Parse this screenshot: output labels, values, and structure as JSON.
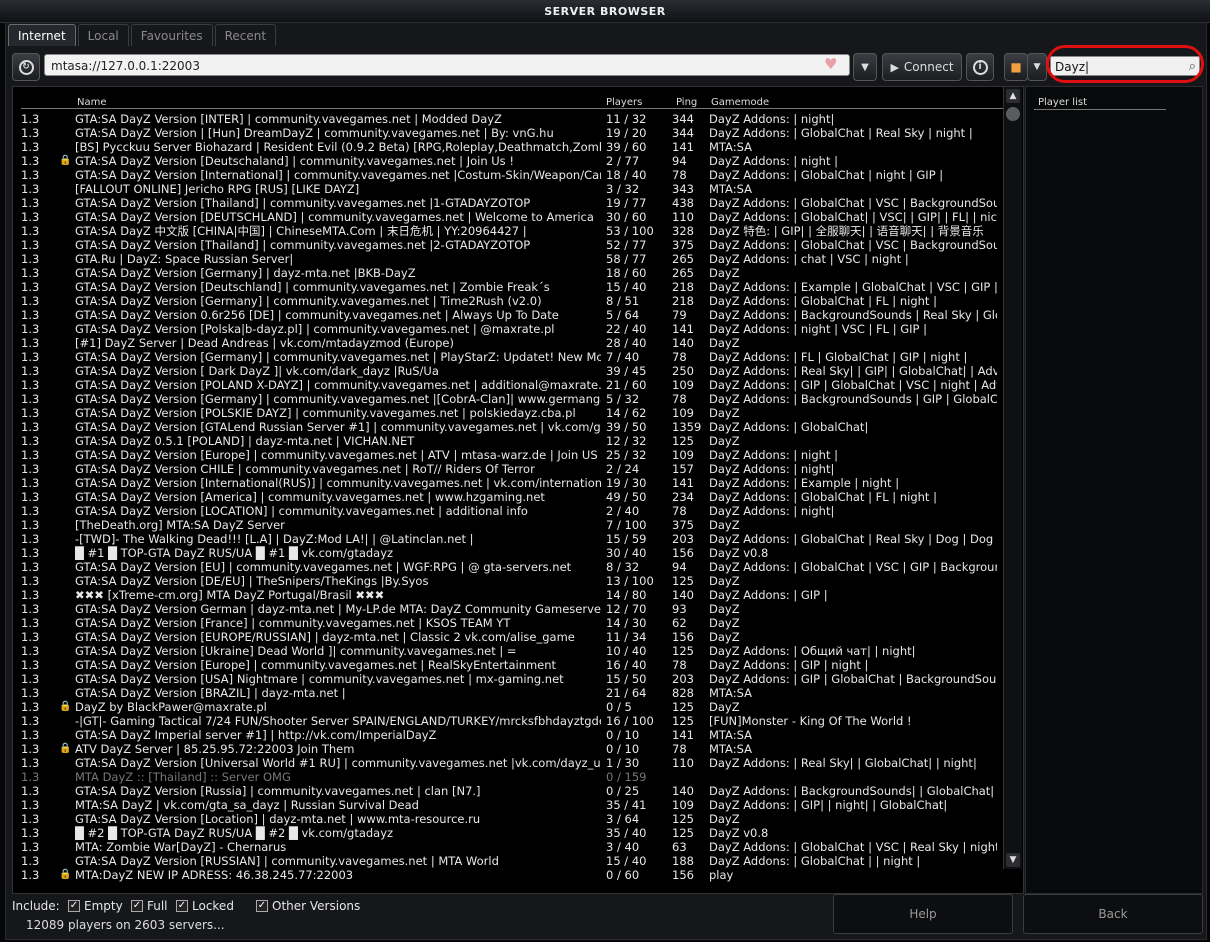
{
  "window": {
    "title": "SERVER BROWSER"
  },
  "tabs": [
    {
      "label": "Internet",
      "active": true
    },
    {
      "label": "Local",
      "active": false
    },
    {
      "label": "Favourites",
      "active": false
    },
    {
      "label": "Recent",
      "active": false
    }
  ],
  "toolbar": {
    "address": "mtasa://127.0.0.1:22003",
    "connect_label": "Connect",
    "search_value": "Dayz"
  },
  "columns": {
    "name": "Name",
    "players": "Players",
    "ping": "Ping",
    "gamemode": "Gamemode"
  },
  "player_list": {
    "title": "Player list"
  },
  "rows": [
    [
      "1.3",
      "",
      "GTA:SA DayZ Version [INTER] | community.vavegames.net | Modded DayZ",
      "11 / 32",
      "344",
      "DayZ Addons: | night|"
    ],
    [
      "1.3",
      "",
      "GTA:SA DayZ Version | [Hun] DreamDayZ | community.vavegames.net | By: vnG.hu",
      "19 / 20",
      "344",
      "DayZ Addons: | GlobalChat | Real Sky | night |"
    ],
    [
      "1.3",
      "",
      "[BS] Pycckuu Server Biohazard | Resident Evil (0.9.2 Beta) [RPG,Roleplay,Deathmatch,Zombie,D",
      "39 / 60",
      "141",
      "MTA:SA"
    ],
    [
      "1.3",
      "lock",
      "GTA:SA DayZ Version  [Deutschaland] | community.vavegames.net | Join Us !",
      "2 / 77",
      "94",
      "DayZ Addons: | night |"
    ],
    [
      "1.3",
      "",
      "GTA:SA DayZ Version [International] | community.vavegames.net |Costum-Skin/Weapon/Cars/C",
      "18 / 40",
      "78",
      "DayZ Addons: | GlobalChat | night | GIP |"
    ],
    [
      "1.3",
      "",
      "[FALLOUT ONLINE] Jericho RPG [RUS] [LIKE DAYZ]",
      "3 / 32",
      "343",
      "MTA:SA"
    ],
    [
      "1.3",
      "",
      "GTA:SA DayZ Version [Thailand] | community.vavegames.net |1-GTADAYZOTOP",
      "19 / 77",
      "438",
      "DayZ Addons: | GlobalChat | VSC | BackgroundSoun"
    ],
    [
      "1.3",
      "",
      "GTA:SA DayZ Version [DEUTSCHLAND] | community.vavegames.net | Welcome to America",
      "30 / 60",
      "110",
      "DayZ Addons: | GlobalChat| | VSC| | GIP| | FL| | nic"
    ],
    [
      "1.3",
      "",
      "GTA:SA DayZ 中文版 [CHINA|中国] | ChineseMTA.Com | 末日危机 | YY:20964427 |",
      "53 / 100",
      "328",
      "DayZ 特色: | GIP| | 全服聊天| | 语音聊天| | 背景音乐"
    ],
    [
      "1.3",
      "",
      "GTA:SA DayZ Version [Thailand] | community.vavegames.net |2-GTADAYZOTOP",
      "52 / 77",
      "375",
      "DayZ Addons: | GlobalChat | VSC | BackgroundSoun"
    ],
    [
      "1.3",
      "",
      "GTA.Ru | DayZ: Space Russian Server|",
      "58 / 77",
      "265",
      "DayZ Addons: | chat | VSC | night |"
    ],
    [
      "1.3",
      "",
      "GTA:SA DayZ Version [Germany] | dayz-mta.net |BKB-DayZ",
      "18 / 60",
      "265",
      "DayZ"
    ],
    [
      "1.3",
      "",
      "GTA:SA DayZ Version [Deutschland] | community.vavegames.net | Zombie Freak´s",
      "15 / 40",
      "218",
      "DayZ Addons: | Example | GlobalChat | VSC | GIP | I"
    ],
    [
      "1.3",
      "",
      "GTA:SA DayZ Version [Germany] | community.vavegames.net | Time2Rush (v2.0)",
      "8 / 51",
      "218",
      "DayZ Addons: | GlobalChat | FL | night |"
    ],
    [
      "1.3",
      "",
      "GTA:SA DayZ Version 0.6r256 [DE] | community.vavegames.net | Always Up To Date",
      "5 / 64",
      "79",
      "DayZ Addons: | BackgroundSounds | Real Sky | Glob"
    ],
    [
      "1.3",
      "",
      "GTA:SA DayZ Version [Polska|b-dayz.pl] | community.vavegames.net | @maxrate.pl",
      "22 / 40",
      "141",
      "DayZ Addons: | night | VSC | FL | GIP |"
    ],
    [
      "1.3",
      "",
      "[#1] DayZ Server | Dead Andreas | vk.com/mtadayzmod (Europe)",
      "28 / 40",
      "140",
      "DayZ"
    ],
    [
      "1.3",
      "",
      "GTA:SA DayZ Version [Germany] | community.vavegames.net | PlayStarZ: Updatet! New Mods,",
      "7 / 40",
      "78",
      "DayZ Addons: | FL | GlobalChat | GIP | night |"
    ],
    [
      "1.3",
      "",
      "GTA:SA DayZ Version [ Dark DayZ ]| vk.com/dark_dayz |RuS/Ua",
      "39 / 45",
      "250",
      "DayZ Addons: | Real Sky| | GIP| | GlobalChat| | Adv"
    ],
    [
      "1.3",
      "",
      "GTA:SA DayZ Version [POLAND X-DAYZ] | community.vavegames.net | additional@maxrate.pl",
      "21 / 60",
      "109",
      "DayZ Addons: | GIP | GlobalChat | VSC | night | Adv"
    ],
    [
      "1.3",
      "",
      "GTA:SA DayZ Version [Germany] | community.vavegames.net |[CobrA-Clan]| www.germangam",
      "5 / 32",
      "78",
      "DayZ Addons: | BackgroundSounds | GIP | GlobalCha"
    ],
    [
      "1.3",
      "",
      "GTA:SA DayZ Version [POLSKIE DAYZ] | community.vavegames.net | polskiedayz.cba.pl",
      "14 / 62",
      "109",
      "DayZ"
    ],
    [
      "1.3",
      "",
      "GTA:SA DayZ Version [GTALend Russian Server #1] | community.vavegames.net | vk.com/gtale",
      "39 / 50",
      "1359",
      "DayZ Addons: | GlobalChat|"
    ],
    [
      "1.3",
      "",
      "GTA:SA DayZ 0.5.1 [POLAND] | dayz-mta.net | VICHAN.NET",
      "12 / 32",
      "125",
      "DayZ"
    ],
    [
      "1.3",
      "",
      "GTA:SA DayZ Version [Europe] | community.vavegames.net | ATV | mtasa-warz.de | Join US 4",
      "25 / 32",
      "109",
      "DayZ Addons: | night |"
    ],
    [
      "1.3",
      "",
      "GTA:SA DayZ Version CHILE | community.vavegames.net | RoT// Riders Of Terror",
      "2 / 24",
      "157",
      "DayZ Addons: | night|"
    ],
    [
      "1.3",
      "",
      "GTA:SA DayZ Version [International(RUS)] | community.vavegames.net | vk.com/internationald",
      "19 / 30",
      "141",
      "DayZ Addons: | Example | night |"
    ],
    [
      "1.3",
      "",
      "GTA:SA DayZ Version [America] | community.vavegames.net | www.hzgaming.net",
      "49 / 50",
      "234",
      "DayZ Addons: | GlobalChat | FL | night |"
    ],
    [
      "1.3",
      "",
      "GTA:SA DayZ Version [LOCATION] | community.vavegames.net | additional info",
      "2 / 40",
      "78",
      "DayZ Addons: | night|"
    ],
    [
      "1.3",
      "",
      "[TheDeath.org] MTA:SA DayZ Server",
      "7 / 100",
      "375",
      "DayZ"
    ],
    [
      "1.3",
      "",
      "-[TWD]- The Walking Dead!!! [L.A] | DayZ:Mod LA!| | @Latinclan.net |",
      "15 / 59",
      "203",
      "DayZ Addons: | GlobalChat | Real Sky | Dog | Dog |"
    ],
    [
      "1.3",
      "",
      "█ #1 █ TOP-GTA DayZ RUS/UA █ #1 █ vk.com/gtadayz",
      "30 / 40",
      "156",
      "DayZ v0.8"
    ],
    [
      "1.3",
      "",
      "GTA:SA DayZ Version [EU] | community.vavegames.net | WGF:RPG | @ gta-servers.net",
      "8 / 32",
      "94",
      "DayZ Addons: | GlobalChat | VSC | GIP | Backgroun"
    ],
    [
      "1.3",
      "",
      "GTA:SA DayZ Version [DE/EU] | TheSnipers/TheKings |By.Syos",
      "13 / 100",
      "125",
      "DayZ"
    ],
    [
      "1.3",
      "",
      "✖✖✖ [xTreme-cm.org] MTA DayZ Portugal/Brasil ✖✖✖",
      "14 / 80",
      "140",
      "DayZ Addons: | GIP |"
    ],
    [
      "1.3",
      "",
      "GTA:SA DayZ Version German | dayz-mta.net | My-LP.de MTA: DayZ Community Gameserver",
      "12 / 70",
      "93",
      "DayZ"
    ],
    [
      "1.3",
      "",
      "GTA:SA DayZ Version [France] | community.vavegames.net | KSOS TEAM YT",
      "14 / 30",
      "62",
      "DayZ"
    ],
    [
      "1.3",
      "",
      "GTA:SA DayZ Version [EUROPE/RUSSIAN] | dayz-mta.net | Classic 2 vk.com/alise_game",
      "11 / 34",
      "156",
      "DayZ"
    ],
    [
      "1.3",
      "",
      "GTA:SA DayZ Version [Ukraine] Dead World                    ]| community.vavegames.net | =",
      "10 / 40",
      "125",
      "DayZ Addons: | Общий чат| | night|"
    ],
    [
      "1.3",
      "",
      "GTA:SA DayZ Version [Europe] | community.vavegames.net | RealSkyEntertainment",
      "16 / 40",
      "78",
      "DayZ Addons: | GIP | night |"
    ],
    [
      "1.3",
      "",
      "GTA:SA DayZ Version [USA] Nightmare | community.vavegames.net | mx-gaming.net",
      "15 / 50",
      "203",
      "DayZ Addons: | GIP | GlobalChat | BackgroundSoun"
    ],
    [
      "1.3",
      "",
      "GTA:SA DayZ Version [BRAZIL] | dayz-mta.net |",
      "21 / 64",
      "828",
      "MTA:SA"
    ],
    [
      "1.3",
      "lock",
      "DayZ by BlackPawer@maxrate.pl",
      "0 / 5",
      "125",
      "DayZ"
    ],
    [
      "1.3",
      "",
      "-|GT|- Gaming Tactical 7/24 FUN/Shooter Server SPAIN/ENGLAND/TURKEY/mrcksfbhdayztgdefa",
      "16 / 100",
      "125",
      "[FUN]Monster - King Of The World !"
    ],
    [
      "1.3",
      "",
      "GTA:SA DayZ Imperial server #1] | http://vk.com/ImperialDayZ",
      "0 / 10",
      "141",
      "MTA:SA"
    ],
    [
      "1.3",
      "lock",
      "ATV DayZ Server | 85.25.95.72:22003 Join Them",
      "0 / 10",
      "78",
      "MTA:SA"
    ],
    [
      "1.3",
      "",
      "GTA:SA DayZ Version [Universal World #1 RU] | community.vavegames.net |vk.com/dayz_unive",
      "1 / 30",
      "110",
      "DayZ Addons: | Real Sky| | GlobalChat| | night|"
    ],
    [
      "1.3",
      "",
      "MTA DayZ :: [Thailand] :: Server OMG",
      "0 / 159",
      "",
      "",
      "grey"
    ],
    [
      "1.3",
      "",
      "GTA:SA DayZ Version [Russia] | community.vavegames.net | clan [N7.]",
      "0 / 25",
      "140",
      "DayZ Addons: | BackgroundSounds| | GlobalChat|"
    ],
    [
      "1.3",
      "",
      "MTA:SA DayZ | vk.com/gta_sa_dayz | Russian Survival Dead",
      "35 / 41",
      "109",
      "DayZ Addons: | GIP| | night| | GlobalChat|"
    ],
    [
      "1.3",
      "",
      "GTA:SA DayZ Version [Location] | dayz-mta.net | www.mta-resource.ru",
      "3 / 64",
      "125",
      "DayZ"
    ],
    [
      "1.3",
      "",
      "█ #2 █ TOP-GTA DayZ RUS/UA █ #2 █ vk.com/gtadayz",
      "35 / 40",
      "125",
      "DayZ v0.8"
    ],
    [
      "1.3",
      "",
      "MTA: Zombie War[DayZ] - Chernarus",
      "3 / 40",
      "63",
      "DayZ Addons: | GlobalChat | VSC | Real Sky | night"
    ],
    [
      "1.3",
      "",
      "GTA:SA DayZ Version [RUSSIAN] | community.vavegames.net | MTA World",
      "15 / 40",
      "188",
      "DayZ Addons: | GlobalChat |   | night |"
    ],
    [
      "1.3",
      "lock",
      "MTA:DayZ NEW IP ADRESS: 46.38.245.77:22003",
      "0 / 60",
      "156",
      "play"
    ]
  ],
  "include": {
    "label": "Include:",
    "options": [
      {
        "label": "Empty",
        "checked": true
      },
      {
        "label": "Full",
        "checked": true
      },
      {
        "label": "Locked",
        "checked": true
      },
      {
        "label": "Other Versions",
        "checked": true
      }
    ]
  },
  "status": "12089 players on 2603 servers...",
  "buttons": {
    "help": "Help",
    "back": "Back"
  }
}
